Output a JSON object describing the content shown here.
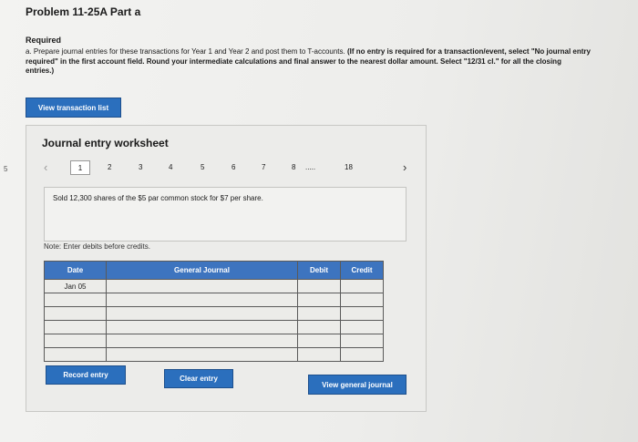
{
  "header": {
    "title": "Problem 11-25A Part a",
    "edge_mark": "5"
  },
  "instructions": {
    "required_label": "Required",
    "text_plain": "a. Prepare journal entries for these transactions for Year 1 and Year 2 and post them to T-accounts.",
    "text_bold": "(If no entry is required for a transaction/event, select \"No journal entry required\" in the first account field. Round your intermediate calculations and final answer to the nearest dollar amount. Select \"12/31 cl.\" for all the closing entries.)"
  },
  "buttons": {
    "view_transaction_list": "View transaction list",
    "record_entry": "Record entry",
    "clear_entry": "Clear entry",
    "view_general_journal": "View general journal"
  },
  "worksheet": {
    "title": "Journal entry worksheet",
    "pager": {
      "prev_icon": "chevron-left-icon",
      "next_icon": "chevron-right-icon",
      "pages": [
        "1",
        "2",
        "3",
        "4",
        "5",
        "6",
        "7",
        "8"
      ],
      "ellipsis": ".....",
      "last_page": "18",
      "selected": "1"
    },
    "description": "Sold 12,300 shares of the $5 par common stock for $7 per share.",
    "note": "Note: Enter debits before credits.",
    "table": {
      "headers": {
        "date": "Date",
        "account": "General Journal",
        "debit": "Debit",
        "credit": "Credit"
      },
      "rows": [
        {
          "date": "Jan 05",
          "account": "",
          "debit": "",
          "credit": ""
        },
        {
          "date": "",
          "account": "",
          "debit": "",
          "credit": ""
        },
        {
          "date": "",
          "account": "",
          "debit": "",
          "credit": ""
        },
        {
          "date": "",
          "account": "",
          "debit": "",
          "credit": ""
        },
        {
          "date": "",
          "account": "",
          "debit": "",
          "credit": ""
        },
        {
          "date": "",
          "account": "",
          "debit": "",
          "credit": ""
        }
      ]
    }
  },
  "colors": {
    "button_blue": "#2b6fbd",
    "table_header_blue": "#3d74bf"
  }
}
